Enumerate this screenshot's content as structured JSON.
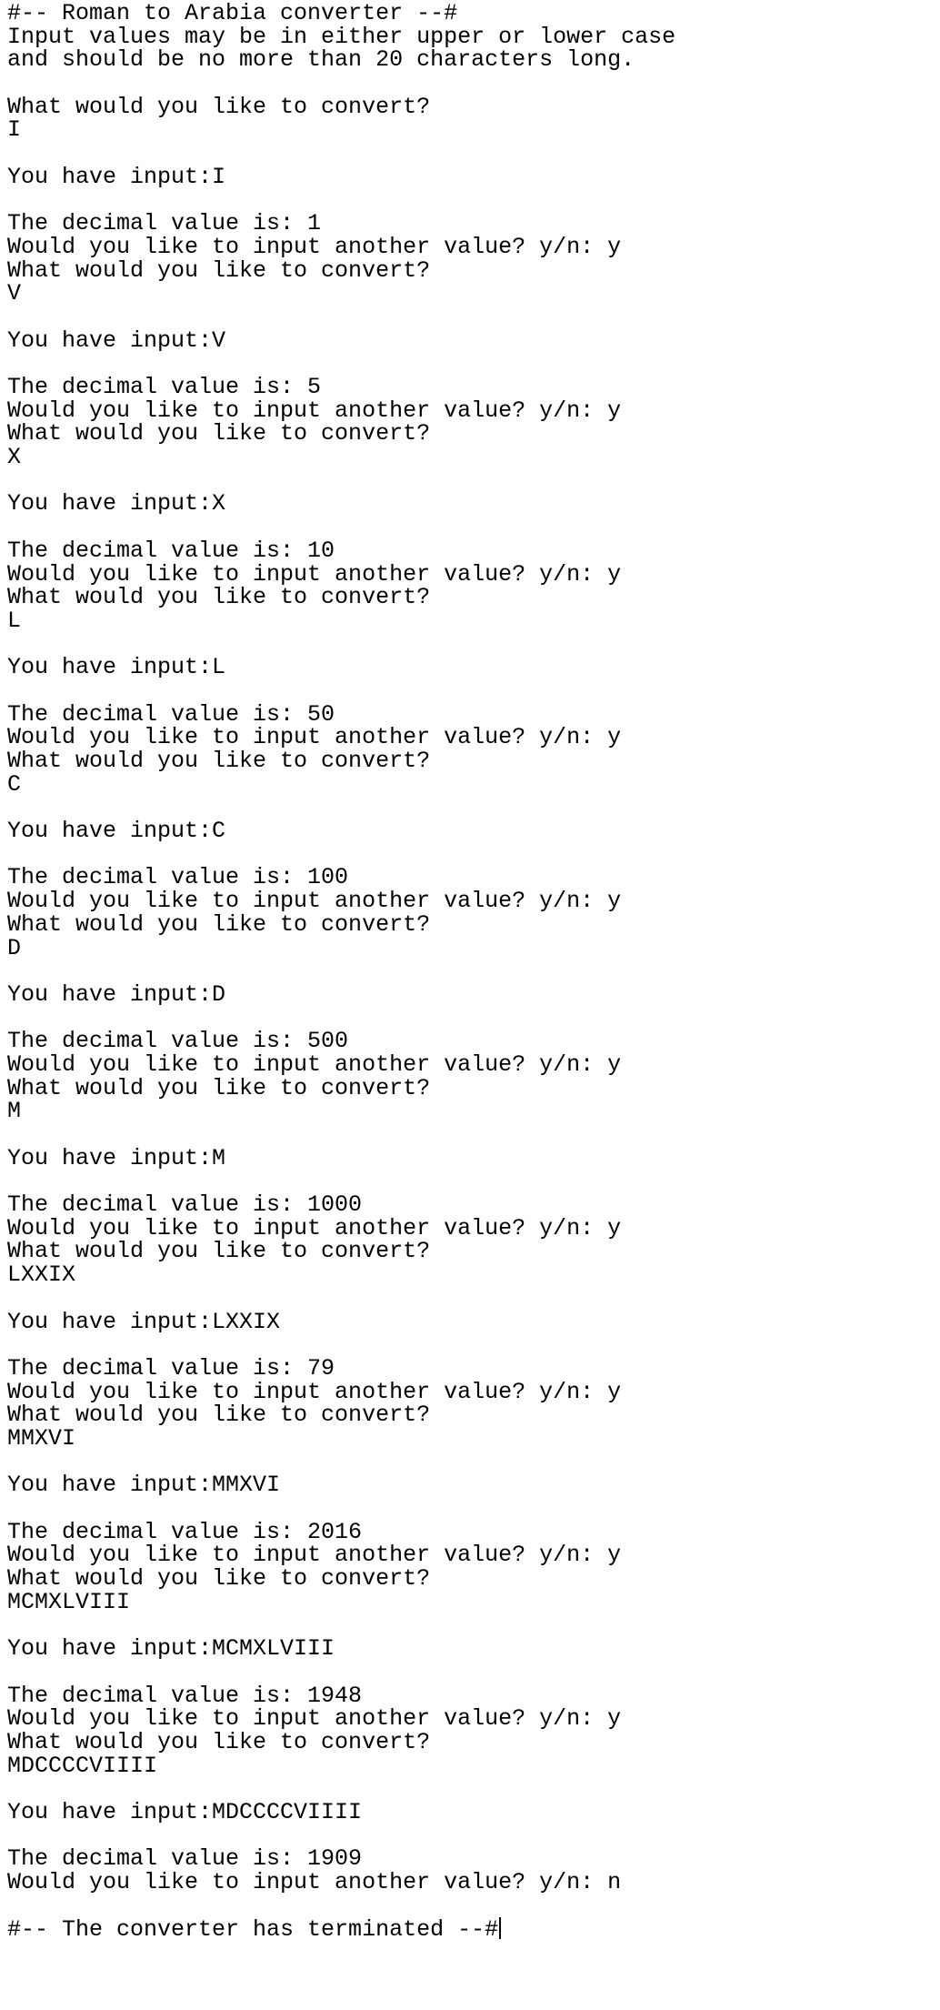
{
  "terminal": {
    "lines": [
      "#-- Roman to Arabia converter --#",
      "Input values may be in either upper or lower case",
      "and should be no more than 20 characters long.",
      "",
      "What would you like to convert?",
      "I",
      "",
      "You have input:I",
      "",
      "The decimal value is: 1",
      "Would you like to input another value? y/n: y",
      "What would you like to convert?",
      "V",
      "",
      "You have input:V",
      "",
      "The decimal value is: 5",
      "Would you like to input another value? y/n: y",
      "What would you like to convert?",
      "X",
      "",
      "You have input:X",
      "",
      "The decimal value is: 10",
      "Would you like to input another value? y/n: y",
      "What would you like to convert?",
      "L",
      "",
      "You have input:L",
      "",
      "The decimal value is: 50",
      "Would you like to input another value? y/n: y",
      "What would you like to convert?",
      "C",
      "",
      "You have input:C",
      "",
      "The decimal value is: 100",
      "Would you like to input another value? y/n: y",
      "What would you like to convert?",
      "D",
      "",
      "You have input:D",
      "",
      "The decimal value is: 500",
      "Would you like to input another value? y/n: y",
      "What would you like to convert?",
      "M",
      "",
      "You have input:M",
      "",
      "The decimal value is: 1000",
      "Would you like to input another value? y/n: y",
      "What would you like to convert?",
      "LXXIX",
      "",
      "You have input:LXXIX",
      "",
      "The decimal value is: 79",
      "Would you like to input another value? y/n: y",
      "What would you like to convert?",
      "MMXVI",
      "",
      "You have input:MMXVI",
      "",
      "The decimal value is: 2016",
      "Would you like to input another value? y/n: y",
      "What would you like to convert?",
      "MCMXLVIII",
      "",
      "You have input:MCMXLVIII",
      "",
      "The decimal value is: 1948",
      "Would you like to input another value? y/n: y",
      "What would you like to convert?",
      "MDCCCCVIIII",
      "",
      "You have input:MDCCCCVIIII",
      "",
      "The decimal value is: 1909",
      "Would you like to input another value? y/n: n",
      "",
      "#-- The converter has terminated --#"
    ]
  }
}
